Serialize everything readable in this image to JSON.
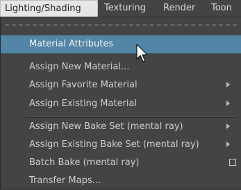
{
  "menubar": {
    "items": [
      {
        "label": "Lighting/Shading",
        "active": true
      },
      {
        "label": "Texturing"
      },
      {
        "label": "Render"
      },
      {
        "label": "Toon"
      }
    ]
  },
  "menu": {
    "items": [
      {
        "label": "Material Attributes",
        "highlighted": true
      },
      {
        "label": "Assign New Material..."
      },
      {
        "label": "Assign Favorite Material",
        "submenu": true
      },
      {
        "label": "Assign Existing Material",
        "submenu": true
      },
      {
        "label": "Assign New Bake Set (mental ray)",
        "submenu": true
      },
      {
        "label": "Assign Existing Bake Set (mental ray)",
        "submenu": true
      },
      {
        "label": "Batch Bake (mental ray)",
        "option_box": true
      },
      {
        "label": "Transfer Maps..."
      }
    ]
  },
  "colors": {
    "menu_background": "#444444",
    "highlight": "#5285a6",
    "active_menu_title": "#e6e6e6"
  },
  "icons": [
    "submenu-arrow-icon",
    "option-box-icon",
    "mouse-cursor-icon"
  ]
}
